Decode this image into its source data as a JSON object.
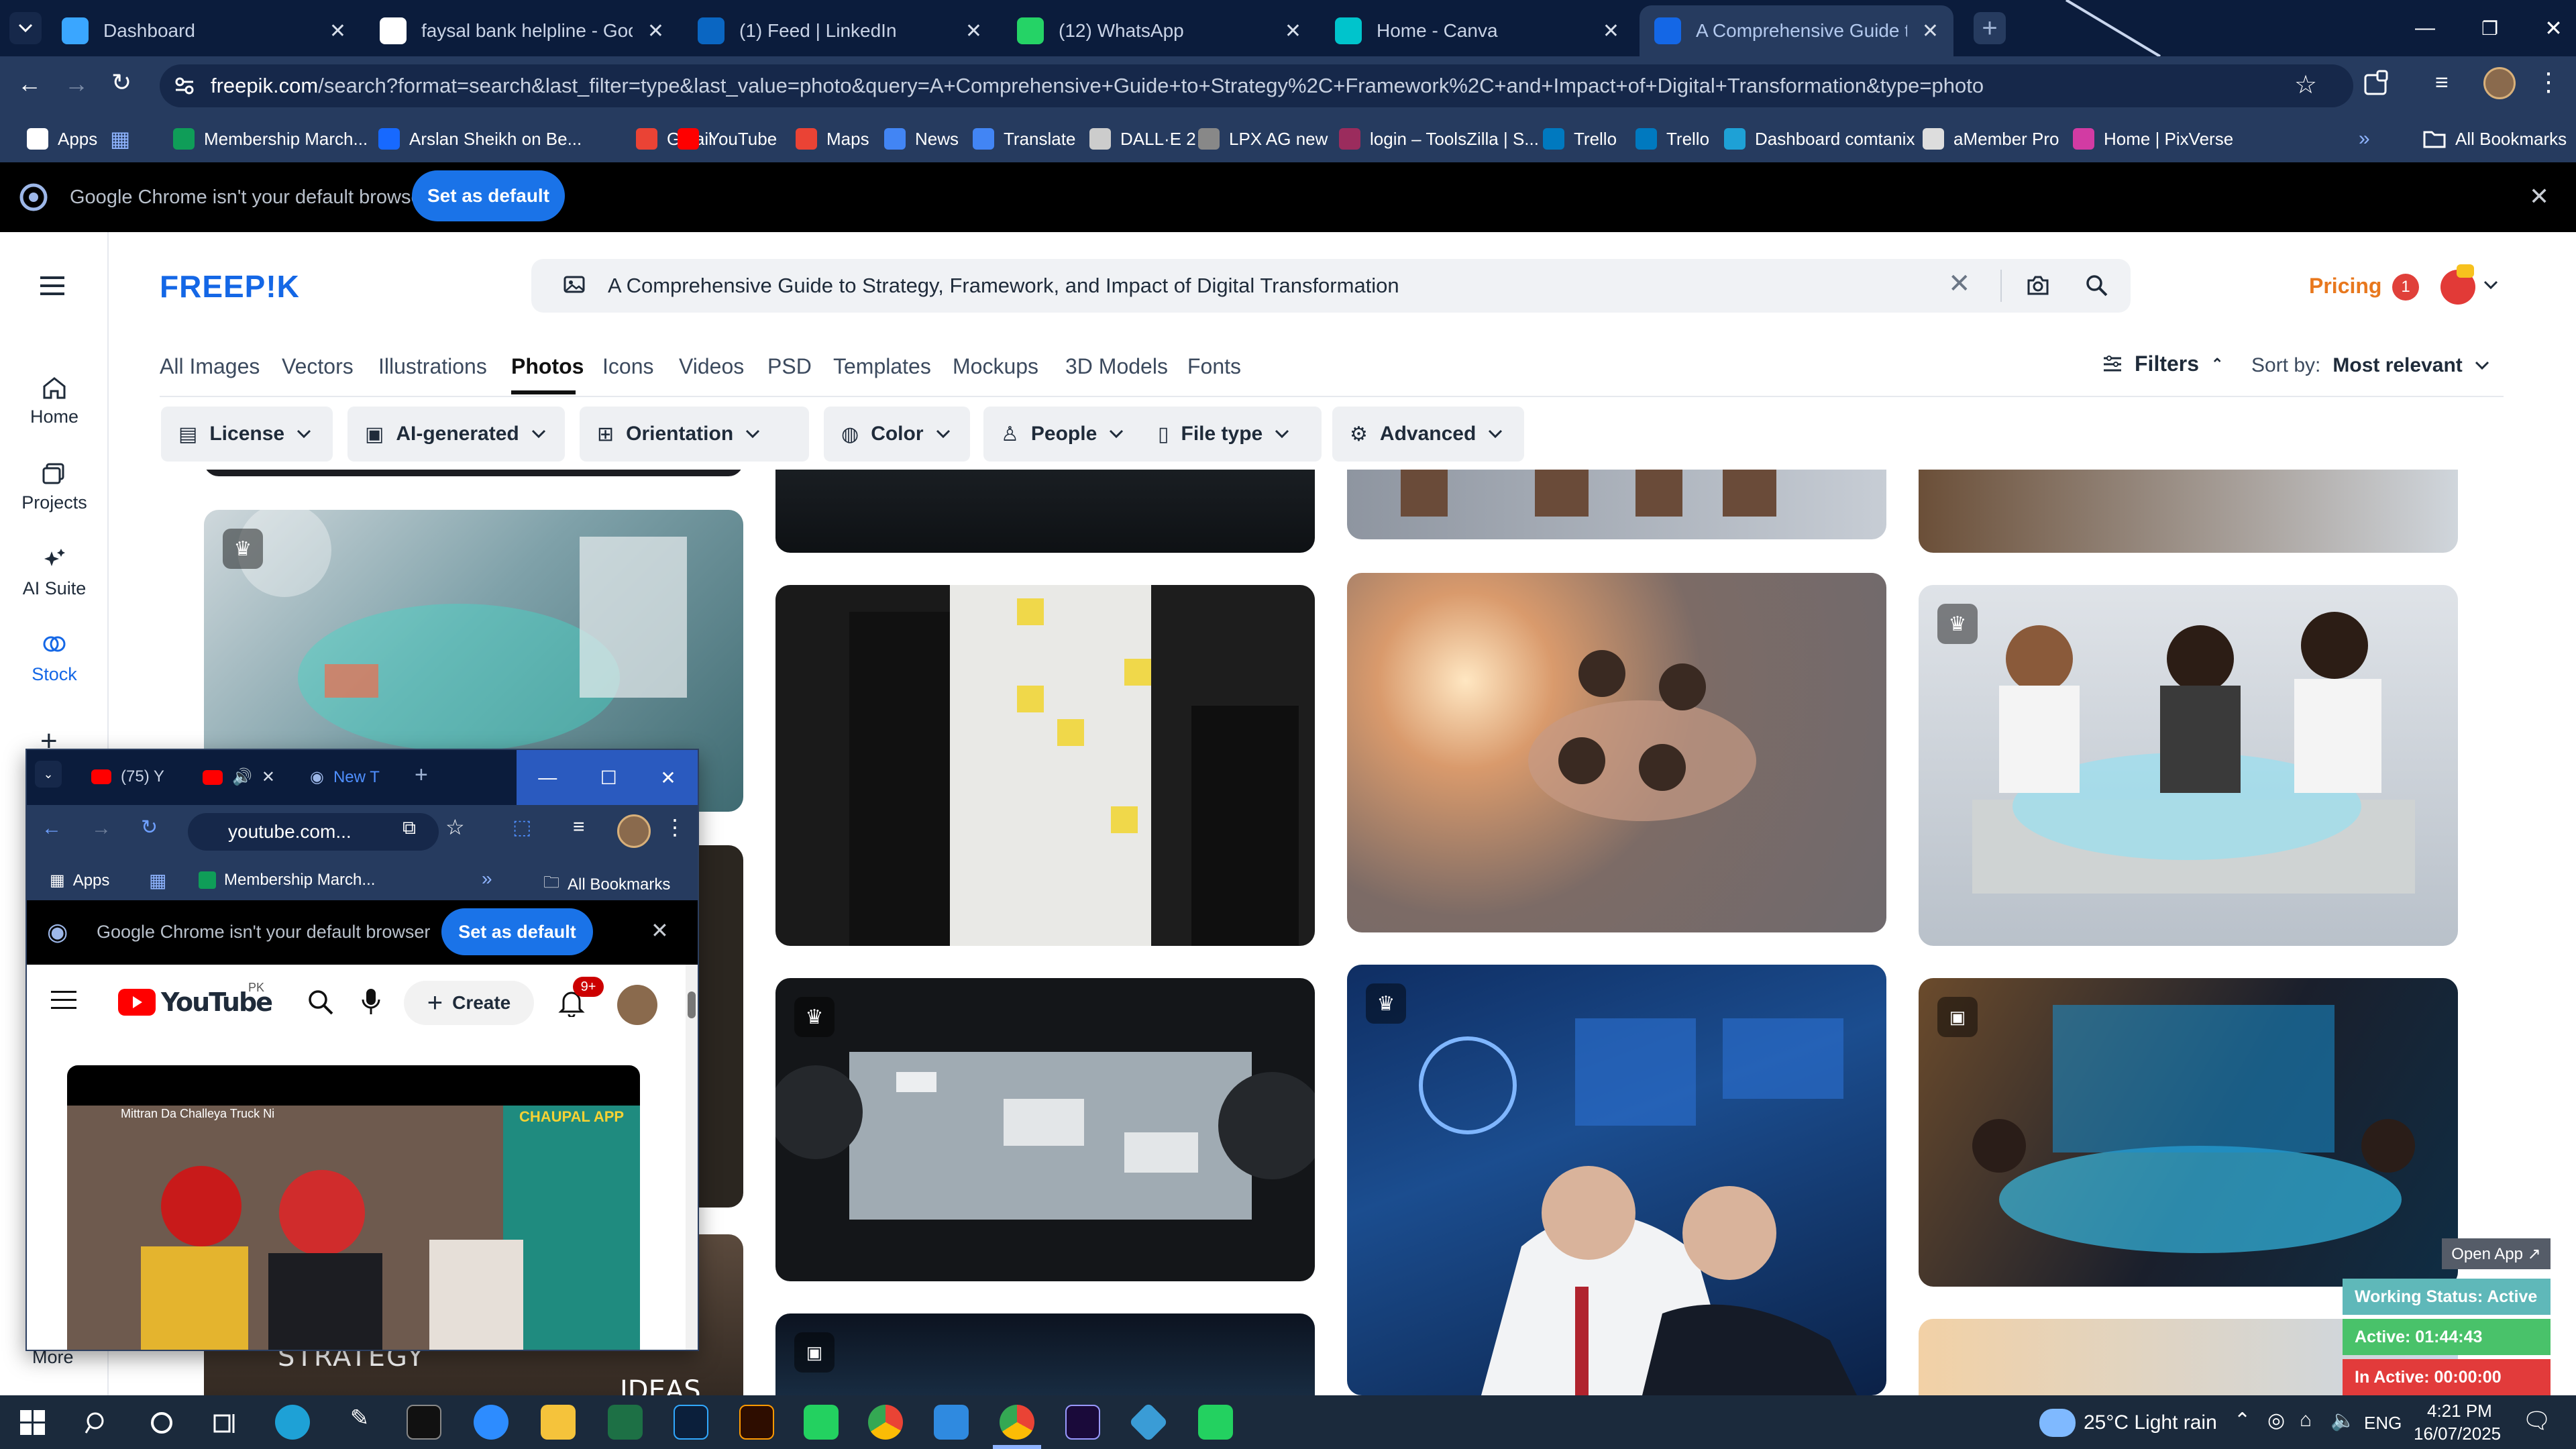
{
  "browser": {
    "tabs": [
      {
        "title": "Dashboard",
        "color": "#3aa6ff"
      },
      {
        "title": "faysal bank helpline - Google S",
        "color": "#ffffff"
      },
      {
        "title": "(1) Feed | LinkedIn",
        "color": "#0a66c2"
      },
      {
        "title": "(12) WhatsApp",
        "color": "#25d366"
      },
      {
        "title": "Home - Canva",
        "color": "#00c4cc"
      },
      {
        "title": "A Comprehensive Guide to Stra",
        "color": "#1467e6"
      }
    ],
    "url_domain": "freepik.com",
    "url_path": "/search?format=search&last_filter=type&last_value=photo&query=A+Comprehensive+Guide+to+Strategy%2C+Framework%2C+and+Impact+of+Digital+Transformation&type=photo",
    "bookmarks": [
      {
        "label": "Apps",
        "color": "#ffffff"
      },
      {
        "label": "Membership March...",
        "color": "#0f9d58"
      },
      {
        "label": "Arslan Sheikh on Be...",
        "color": "#1769ff"
      },
      {
        "label": "Gmail",
        "color": "#ea4335"
      },
      {
        "label": "YouTube",
        "color": "#ff0000"
      },
      {
        "label": "Maps",
        "color": "#ea4335"
      },
      {
        "label": "News",
        "color": "#4285f4"
      },
      {
        "label": "Translate",
        "color": "#4285f4"
      },
      {
        "label": "DALL·E 2",
        "color": "#cccccc"
      },
      {
        "label": "LPX AG new",
        "color": "#888888"
      },
      {
        "label": "login – ToolsZilla | S...",
        "color": "#9b2c5d"
      },
      {
        "label": "Trello",
        "color": "#0079bf"
      },
      {
        "label": "Trello",
        "color": "#0079bf"
      },
      {
        "label": "Dashboard comtanix",
        "color": "#1ea1d6"
      },
      {
        "label": "aMember Pro",
        "color": "#dddddd"
      },
      {
        "label": "Home | PixVerse",
        "color": "#d23ba3"
      }
    ],
    "all_bookmarks": "All Bookmarks",
    "infobar_text": "Google Chrome isn't your default browser",
    "infobar_button": "Set as default"
  },
  "freepik": {
    "logo": "FREEP!K",
    "search_query": "A Comprehensive Guide to Strategy, Framework, and Impact of Digital Transformation",
    "pricing": "Pricing",
    "notif_count": "1",
    "sidebar": [
      {
        "label": "Home",
        "icon": "home-icon"
      },
      {
        "label": "Projects",
        "icon": "projects-icon"
      },
      {
        "label": "AI Suite",
        "icon": "ai-suite-icon"
      },
      {
        "label": "Stock",
        "icon": "stock-icon"
      }
    ],
    "sidebar_more": "More",
    "categories": [
      "All Images",
      "Vectors",
      "Illustrations",
      "Photos",
      "Icons",
      "Videos",
      "PSD",
      "Templates",
      "Mockups",
      "3D Models",
      "Fonts"
    ],
    "active_category": "Photos",
    "filters_label": "Filters",
    "sort_label": "Sort by:",
    "sort_value": "Most relevant",
    "chips": [
      "License",
      "AI-generated",
      "Orientation",
      "Color",
      "People",
      "File type",
      "Advanced"
    ],
    "card_strategy_text": "STRATEGY",
    "card_ideas_text": "IDEAS"
  },
  "mini_window": {
    "tabs": [
      {
        "title": "(75) Y"
      },
      {
        "title": ""
      },
      {
        "title": "New T"
      }
    ],
    "url": "youtube.com...",
    "bookmark_apps": "Apps",
    "bookmark_membership": "Membership March...",
    "all_bookmarks": "All Bookmarks",
    "infobar_text": "Google Chrome isn't your default browser",
    "infobar_button": "Set as default",
    "yt_logo": "YouTube",
    "yt_country": "PK",
    "create_label": "Create",
    "notif_count": "9+",
    "video_title": "Mittran Da Challeya Truck Ni",
    "video_channel_label": "CHAUPAL APP"
  },
  "working_status": {
    "open_app": "Open App ↗",
    "status": "Working Status: Active",
    "active": "Active: 01:44:43",
    "inactive": "In Active: 00:00:00"
  },
  "taskbar": {
    "weather": "25°C  Light rain",
    "lang": "ENG",
    "time": "4:21 PM",
    "date": "16/07/2025"
  }
}
